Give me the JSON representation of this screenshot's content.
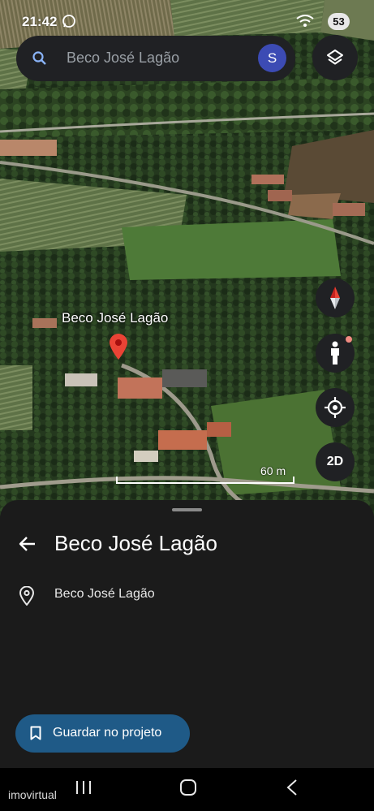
{
  "status_bar": {
    "time": "21:42",
    "battery": "53"
  },
  "search": {
    "query": "Beco José Lagão",
    "avatar_letter": "S"
  },
  "map": {
    "marker_label": "Beco José Lagão",
    "scale_label": "60 m",
    "mode_button": "2D"
  },
  "sheet": {
    "title": "Beco José Lagão",
    "address": "Beco José Lagão",
    "save_button": "Guardar no projeto"
  },
  "watermark": "imovirtual",
  "colors": {
    "accent_button": "#1f5a87",
    "avatar": "#3c4bb4",
    "marker": "#ea4335",
    "sheet_bg": "#1b1b1b"
  },
  "icons": [
    "search-icon",
    "layers-icon",
    "compass-icon",
    "pegman-icon",
    "my-location-icon",
    "back-arrow-icon",
    "location-pin-icon",
    "bookmark-icon"
  ]
}
